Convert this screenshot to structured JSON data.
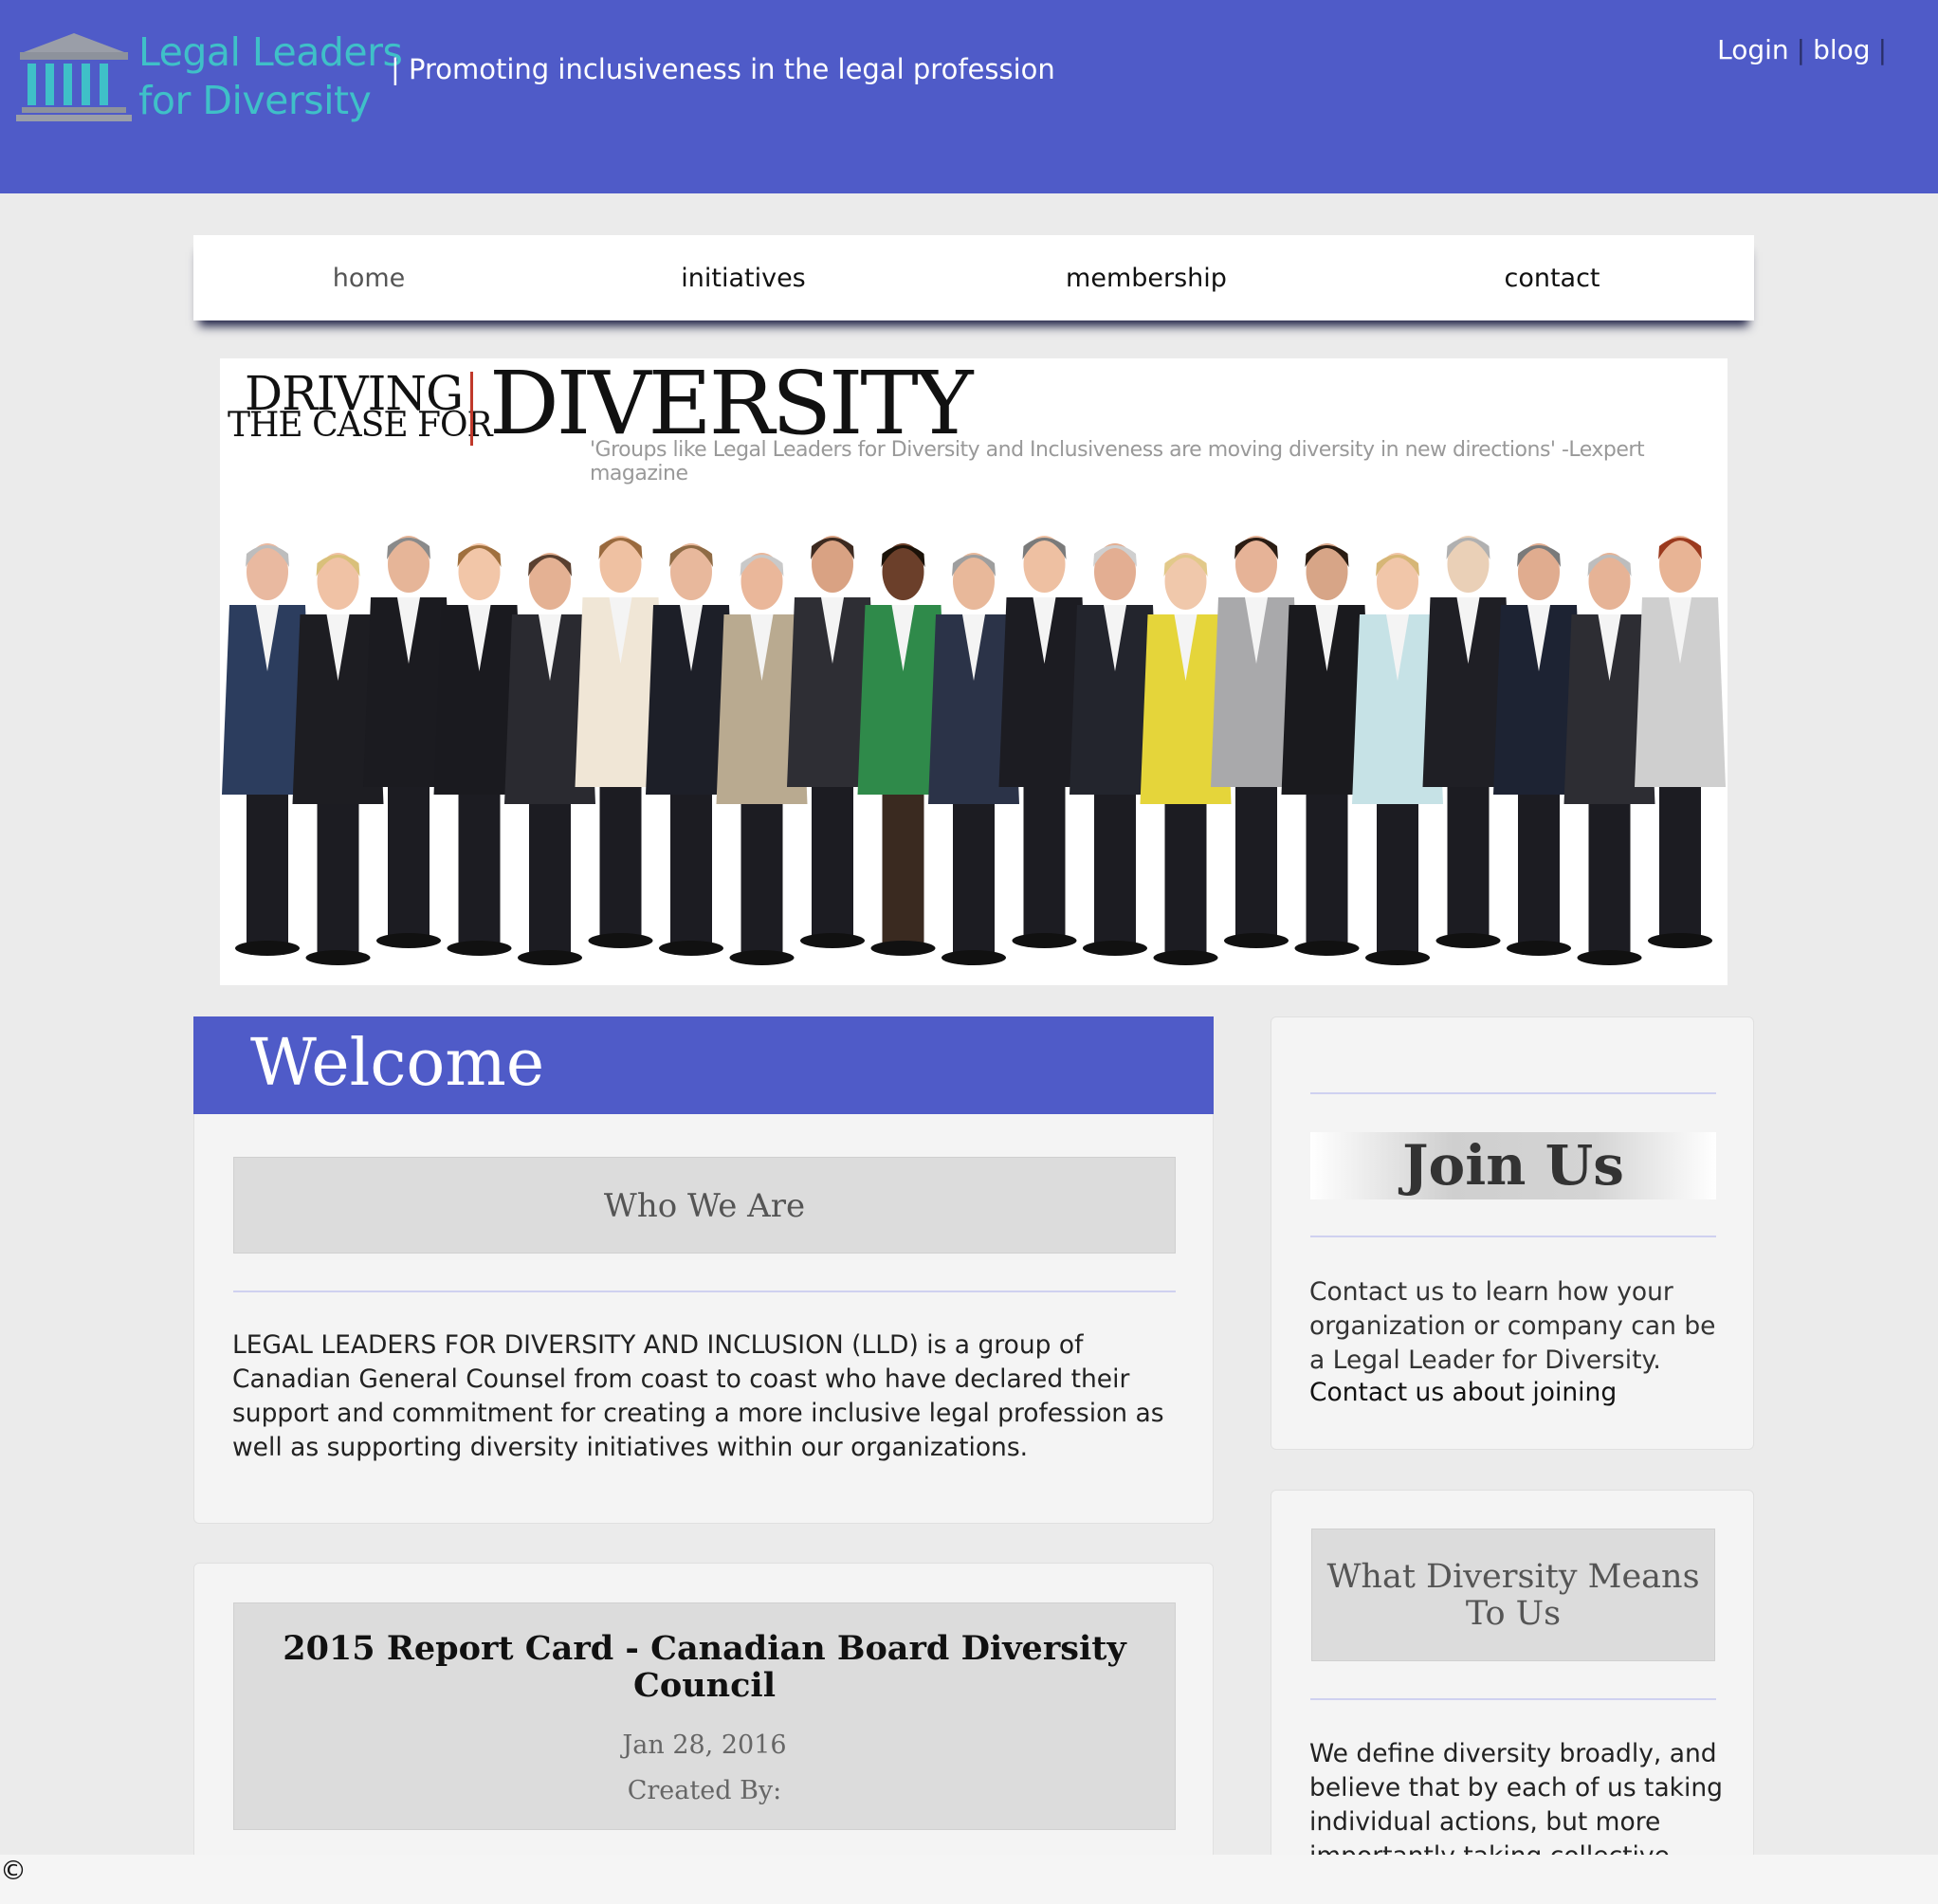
{
  "header": {
    "logo_line1": "Legal Leaders",
    "logo_line2": "for Diversity",
    "tagline": "| Promoting inclusiveness in the legal profession",
    "login": "Login",
    "blog": "blog",
    "sep": "|"
  },
  "nav": {
    "items": [
      "home",
      "initiatives",
      "membership",
      "contact"
    ]
  },
  "banner": {
    "driving": "DRIVING",
    "the_case_for": "THE CASE FOR",
    "diversity": "DIVERSITY",
    "quote": "'Groups like Legal Leaders for Diversity and Inclusiveness are moving diversity in new directions' -Lexpert magazine"
  },
  "welcome": {
    "title": "Welcome",
    "who_heading": "Who We Are",
    "who_text": "LEGAL LEADERS FOR DIVERSITY AND INCLUSION (LLD) is a group of Canadian General Counsel from coast to coast who have declared their support and commitment for creating a more inclusive legal profession as well as supporting diversity initiatives within our organizations."
  },
  "report": {
    "title": "2015 Report Card - Canadian Board Diversity Council",
    "date": "Jan 28, 2016",
    "created_by": "Created By:"
  },
  "join": {
    "heading": "Join Us",
    "text": "Contact us to learn how your organization or company can be a Legal Leader for Diversity.",
    "link": "Contact us about joining"
  },
  "means": {
    "heading": "What Diversity Means To Us",
    "text": "We define diversity broadly, and believe that by each of us taking individual actions, but more importantly taking collective"
  },
  "footer": {
    "copyright": "©"
  },
  "colors": {
    "header_bg": "#4f5bc8",
    "logo_text": "#3fc0c8",
    "page_bg": "#ebebeb"
  }
}
